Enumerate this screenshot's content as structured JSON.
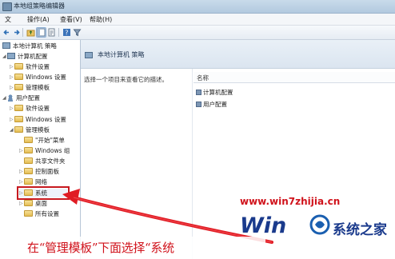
{
  "window": {
    "title": "本地组策略编辑器"
  },
  "menu": {
    "operate": "操作(A)",
    "view": "查看(V)",
    "help": "帮助(H)"
  },
  "tree": {
    "root": "本地计算机 策略",
    "computer_config": "计算机配置",
    "cc_software": "软件设置",
    "cc_windows": "Windows 设置",
    "cc_admin": "管理模板",
    "user_config": "用户配置",
    "uc_software": "软件设置",
    "uc_windows": "Windows 设置",
    "uc_admin": "管理模板",
    "start_menu": "\"开始\"菜单",
    "windows_components": "Windows 组",
    "shared_folders": "共享文件夹",
    "control_panel": "控制面板",
    "network": "网络",
    "system": "系统",
    "desktop": "桌面",
    "all_settings": "所有设置"
  },
  "right": {
    "header_title": "本地计算机 策略",
    "description": "选择一个项目来查看它的描述。",
    "column_name": "名称",
    "items": [
      "计算机配置",
      "用户配置"
    ]
  },
  "overlay": {
    "watermark_url": "www.win7zhijia.cn",
    "watermark_logo_text": "系统之家",
    "caption": "在“管理模板”下面选择“系统",
    "accent_color": "#d0121b"
  }
}
